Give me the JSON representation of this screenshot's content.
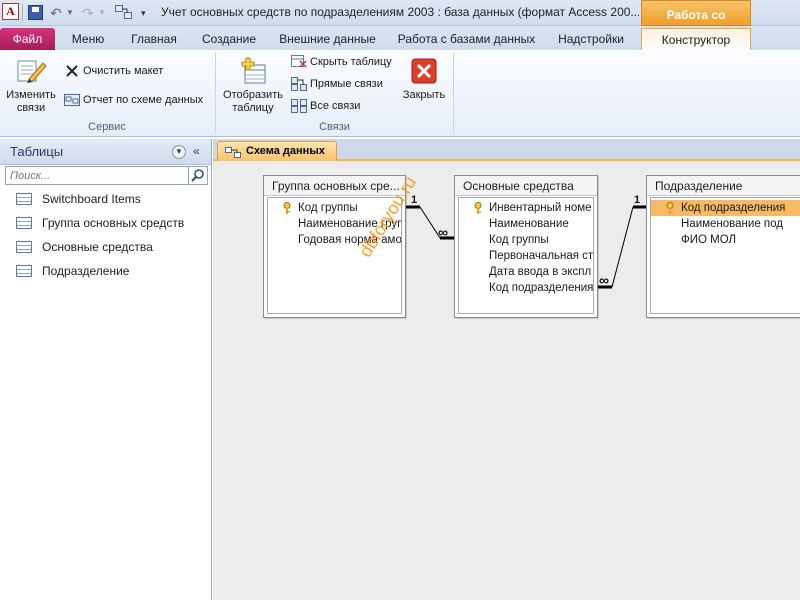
{
  "app": {
    "icon_letter": "A",
    "window_title": "Учет основных средств по подразделениям 2003 : база данных (формат Access 200...",
    "context_tab_header": "Работа со связями"
  },
  "tabs": [
    {
      "label": "Файл"
    },
    {
      "label": "Меню"
    },
    {
      "label": "Главная"
    },
    {
      "label": "Создание"
    },
    {
      "label": "Внешние данные"
    },
    {
      "label": "Работа с базами данных"
    },
    {
      "label": "Надстройки"
    },
    {
      "label": "Конструктор"
    }
  ],
  "ribbon": {
    "groups": [
      {
        "label": "Сервис"
      },
      {
        "label": "Связи"
      }
    ],
    "edit_relations": "Изменить связи",
    "edit_relations_l1": "Изменить",
    "edit_relations_l2": "связи",
    "clear_layout": "Очистить макет",
    "relation_report": "Отчет по схеме данных",
    "show_table_l1": "Отобразить",
    "show_table_l2": "таблицу",
    "hide_table": "Скрыть таблицу",
    "direct_relations": "Прямые связи",
    "all_relations": "Все связи",
    "close": "Закрыть"
  },
  "nav": {
    "title": "Таблицы",
    "search_placeholder": "Поиск...",
    "items": [
      {
        "label": "Switchboard Items"
      },
      {
        "label": "Группа основных средств"
      },
      {
        "label": "Основные средства"
      },
      {
        "label": "Подразделение"
      }
    ]
  },
  "document": {
    "tab_label": "Схема данных",
    "tables": [
      {
        "title": "Группа основных сре...",
        "fields": [
          {
            "name": "Код группы",
            "key": true
          },
          {
            "name": "Наименование груп",
            "key": false
          },
          {
            "name": "Годовая норма амо",
            "key": false
          }
        ]
      },
      {
        "title": "Основные средства",
        "fields": [
          {
            "name": "Инвентарный номе",
            "key": true
          },
          {
            "name": "Наименование",
            "key": false
          },
          {
            "name": "Код группы",
            "key": false
          },
          {
            "name": "Первоначальная ст",
            "key": false
          },
          {
            "name": "Дата ввода в экспл",
            "key": false
          },
          {
            "name": "Код подразделения",
            "key": false
          }
        ]
      },
      {
        "title": "Подразделение",
        "fields": [
          {
            "name": "Код подразделения",
            "key": true,
            "selected": true
          },
          {
            "name": "Наименование под",
            "key": false
          },
          {
            "name": "ФИО МОЛ",
            "key": false
          }
        ]
      }
    ],
    "relations": [
      {
        "one_label": "1",
        "many_label": "∞"
      },
      {
        "one_label": "1",
        "many_label": "∞"
      }
    ]
  },
  "watermark": "dbforyou.ru",
  "colors": {
    "file_tab": "#b8215f",
    "context_accent": "#f1a73a",
    "selected_field": "#f7b963"
  }
}
